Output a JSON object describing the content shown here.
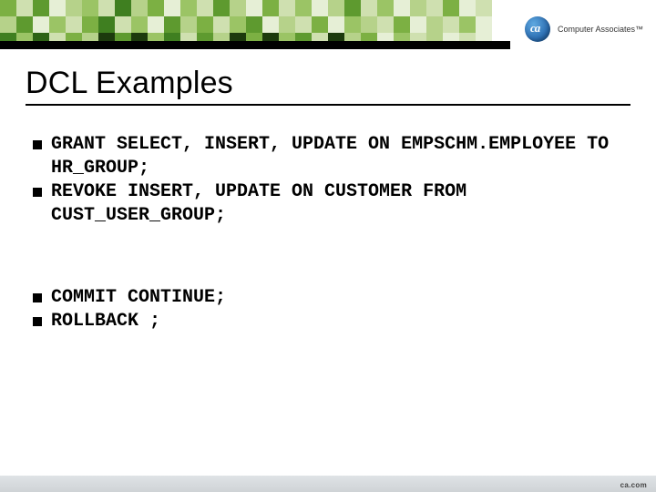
{
  "brand": {
    "company_text": "Computer Associates™",
    "logo_label": "ca"
  },
  "title": "DCL Examples",
  "groups": [
    {
      "bullets": [
        "GRANT SELECT, INSERT, UPDATE ON EMPSCHM.EMPLOYEE TO HR_GROUP;",
        "REVOKE INSERT, UPDATE ON CUSTOMER FROM CUST_USER_GROUP;"
      ]
    },
    {
      "bullets": [
        "COMMIT CONTINUE;",
        "ROLLBACK ;"
      ]
    }
  ],
  "footer": {
    "text": "ca.com"
  },
  "mosaic_palette": {
    "g0": "#f4f8ec",
    "g1": "#e6efd6",
    "g2": "#cfe0b0",
    "g3": "#b6d28a",
    "g4": "#9bc465",
    "g5": "#7cb043",
    "g6": "#5e9a2f",
    "g7": "#3f7f20",
    "g8": "#2d6315",
    "w": "#ffffff",
    "d": "#1c3a0d"
  },
  "mosaic_rows": [
    [
      "g5",
      "g2",
      "g6",
      "g1",
      "g3",
      "g4",
      "g2",
      "g7",
      "g3",
      "g5",
      "g1",
      "g4",
      "g2",
      "g6",
      "g3",
      "g1",
      "g5",
      "g2",
      "g4",
      "g1",
      "g3",
      "g6",
      "g2",
      "g4",
      "g1",
      "g3",
      "g2",
      "g5",
      "g1",
      "g2",
      "w",
      "w"
    ],
    [
      "g3",
      "g6",
      "g1",
      "g4",
      "g2",
      "g5",
      "g7",
      "g2",
      "g4",
      "g1",
      "g6",
      "g3",
      "g5",
      "g2",
      "g4",
      "g6",
      "g1",
      "g3",
      "g2",
      "g5",
      "g1",
      "g4",
      "g3",
      "g2",
      "g5",
      "g1",
      "g3",
      "g2",
      "g4",
      "g1",
      "w",
      "w"
    ],
    [
      "g7",
      "g4",
      "g8",
      "g2",
      "g5",
      "g3",
      "d",
      "g6",
      "d",
      "g4",
      "g7",
      "g2",
      "g6",
      "g3",
      "d",
      "g5",
      "d",
      "g4",
      "g6",
      "g2",
      "d",
      "g3",
      "g5",
      "g1",
      "g4",
      "g2",
      "g3",
      "g1",
      "g2",
      "g1",
      "w",
      "w"
    ]
  ]
}
